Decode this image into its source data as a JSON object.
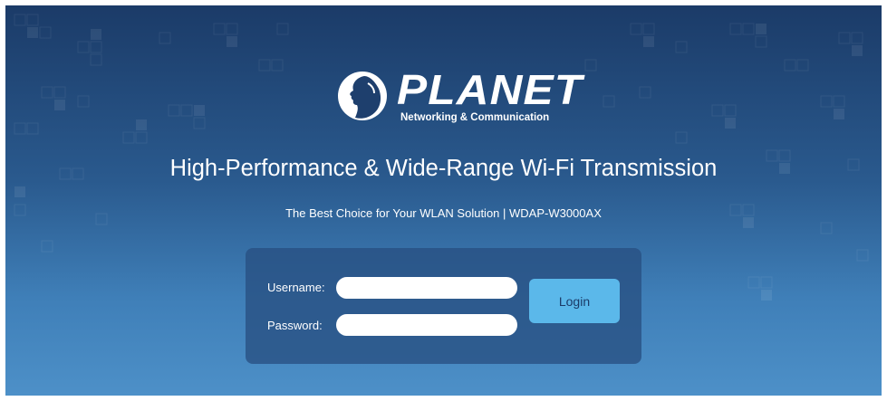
{
  "brand": {
    "name": "PLANET",
    "tagline": "Networking & Communication"
  },
  "headline": "High-Performance & Wide-Range Wi-Fi Transmission",
  "subheadline": "The Best Choice for Your WLAN Solution | WDAP-W3000AX",
  "login": {
    "username_label": "Username:",
    "username_value": "",
    "password_label": "Password:",
    "password_value": "",
    "button_label": "Login"
  },
  "colors": {
    "background_top": "#1b3b68",
    "background_bottom": "#4d90c8",
    "button": "#5bb8ea",
    "text": "#ffffff"
  }
}
